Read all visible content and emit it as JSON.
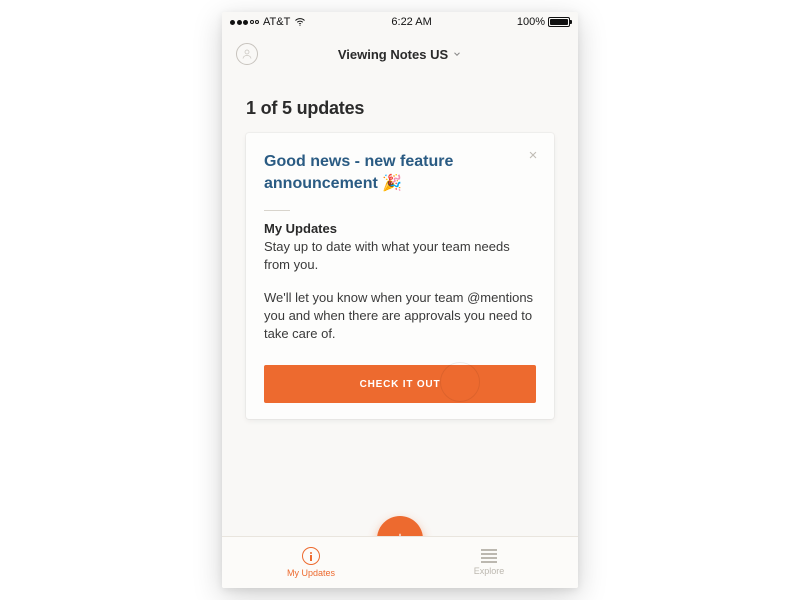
{
  "status_bar": {
    "carrier": "AT&T",
    "time": "6:22 AM",
    "battery_pct": "100%",
    "battery_fill_pct": 100
  },
  "header": {
    "title": "Viewing Notes US"
  },
  "counter": "1 of 5 updates",
  "card": {
    "title": "Good news - new feature announcement 🎉",
    "section_label": "My Updates",
    "paragraph1": "Stay up to date with what your team needs from you.",
    "paragraph2": "We'll let you know when your team @mentions you and when there are approvals you need to take care of.",
    "cta_label": "CHECK IT OUT"
  },
  "tabs": {
    "left_label": "My Updates",
    "right_label": "Explore"
  },
  "colors": {
    "accent": "#ed6a2f",
    "title_link": "#2a5b83"
  }
}
